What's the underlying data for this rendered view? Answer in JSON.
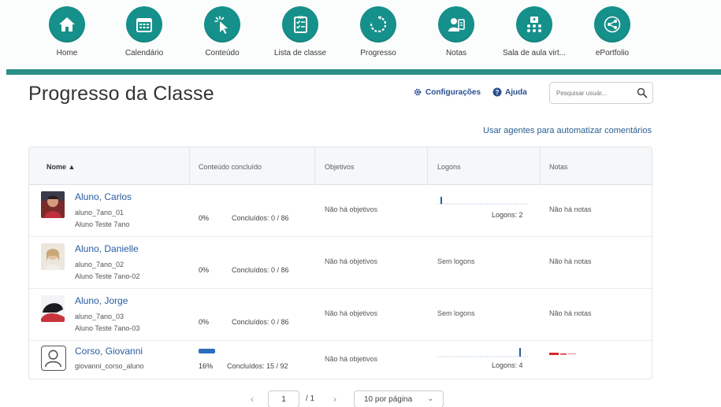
{
  "nav": {
    "items": [
      {
        "label": "Home",
        "icon": "home-icon"
      },
      {
        "label": "Calendário",
        "icon": "calendar-icon"
      },
      {
        "label": "Conteúdo",
        "icon": "content-cursor-icon"
      },
      {
        "label": "Lista de classe",
        "icon": "checklist-icon"
      },
      {
        "label": "Progresso",
        "icon": "progress-refresh-icon"
      },
      {
        "label": "Notas",
        "icon": "grades-icon"
      },
      {
        "label": "Sala de aula virt...",
        "icon": "virtual-classroom-icon"
      },
      {
        "label": "ePortfolio",
        "icon": "share-icon"
      }
    ],
    "accent": "#16908a"
  },
  "header": {
    "title": "Progresso da Classe",
    "settings_label": "Configurações",
    "help_label": "Ajuda",
    "search_placeholder": "Pesquisar usuár..."
  },
  "agents_link": "Usar agentes para automatizar comentários",
  "table": {
    "columns": {
      "name": "Nome ▲",
      "content": "Conteúdo concluído",
      "objectives": "Objetivos",
      "logons": "Logons",
      "notes": "Notas"
    },
    "rows": [
      {
        "name": "Aluno, Carlos",
        "username": "aluno_7ano_01",
        "orgname": "Aluno Teste 7ano",
        "percent": "0%",
        "percent_value": 0,
        "completed": "Concluídos: 0 / 86",
        "objectives": "Não há objetivos",
        "logons": "",
        "logons_count": "Logons: 2",
        "notes": "Não há notas",
        "avatar": "photo-carlos"
      },
      {
        "name": "Aluno, Danielle",
        "username": "aluno_7ano_02",
        "orgname": "Aluno Teste 7ano-02",
        "percent": "0%",
        "percent_value": 0,
        "completed": "Concluídos: 0 / 86",
        "objectives": "Não há objetivos",
        "logons": "Sem logons",
        "logons_count": "",
        "notes": "Não há notas",
        "avatar": "photo-danielle"
      },
      {
        "name": "Aluno, Jorge",
        "username": "aluno_7ano_03",
        "orgname": "Aluno Teste 7ano-03",
        "percent": "0%",
        "percent_value": 0,
        "completed": "Concluídos: 0 / 86",
        "objectives": "Não há objetivos",
        "logons": "Sem logons",
        "logons_count": "",
        "notes": "Não há notas",
        "avatar": "photo-jorge"
      },
      {
        "name": "Corso, Giovanni",
        "username": "giovanni_corso_aluno",
        "orgname": "",
        "percent": "16%",
        "percent_value": 16,
        "completed": "Concluídos: 15 / 92",
        "objectives": "Não há objetivos",
        "logons": "",
        "logons_count": "Logons: 4",
        "notes": "",
        "avatar": "default-user-icon"
      }
    ]
  },
  "pagination": {
    "prev": "‹",
    "next": "›",
    "page": "1",
    "total": "/ 1",
    "per_page": "10 por página"
  },
  "colors": {
    "link": "#2a5d9f",
    "bar": "#2a6ebb",
    "notes_red": "#d9262c"
  }
}
